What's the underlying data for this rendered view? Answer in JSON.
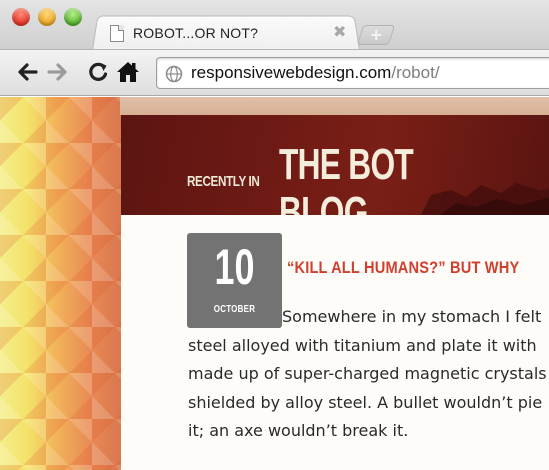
{
  "browser": {
    "tab": {
      "title": "ROBOT...OR NOT?",
      "close_glyph": "✖"
    },
    "new_tab_glyph": "+",
    "address": {
      "host": "responsivewebdesign.com",
      "path": "/robot/"
    },
    "nav_icons": [
      "back-arrow-icon",
      "forward-arrow-icon",
      "reload-icon",
      "home-icon",
      "globe-icon"
    ]
  },
  "page": {
    "banner": {
      "kicker": "RECENTLY IN",
      "title": "THE BOT BLOG"
    },
    "post": {
      "date": {
        "day": "10",
        "month": "OCTOBER"
      },
      "headline": "“KILL ALL HUMANS?” BUT WHY",
      "body_lines": [
        "Somewhere in my stomach I felt",
        "steel alloyed with titanium and plate it with",
        "made up of super-charged magnetic crystals",
        "shielded by alloy steel. A bullet wouldn’t pie",
        "it; an axe wouldn’t break it."
      ]
    }
  },
  "colors": {
    "banner_bg": "#6e1a14",
    "headline": "#d1402e",
    "date_badge": "#737373",
    "article_bg": "#fdfcf8"
  }
}
